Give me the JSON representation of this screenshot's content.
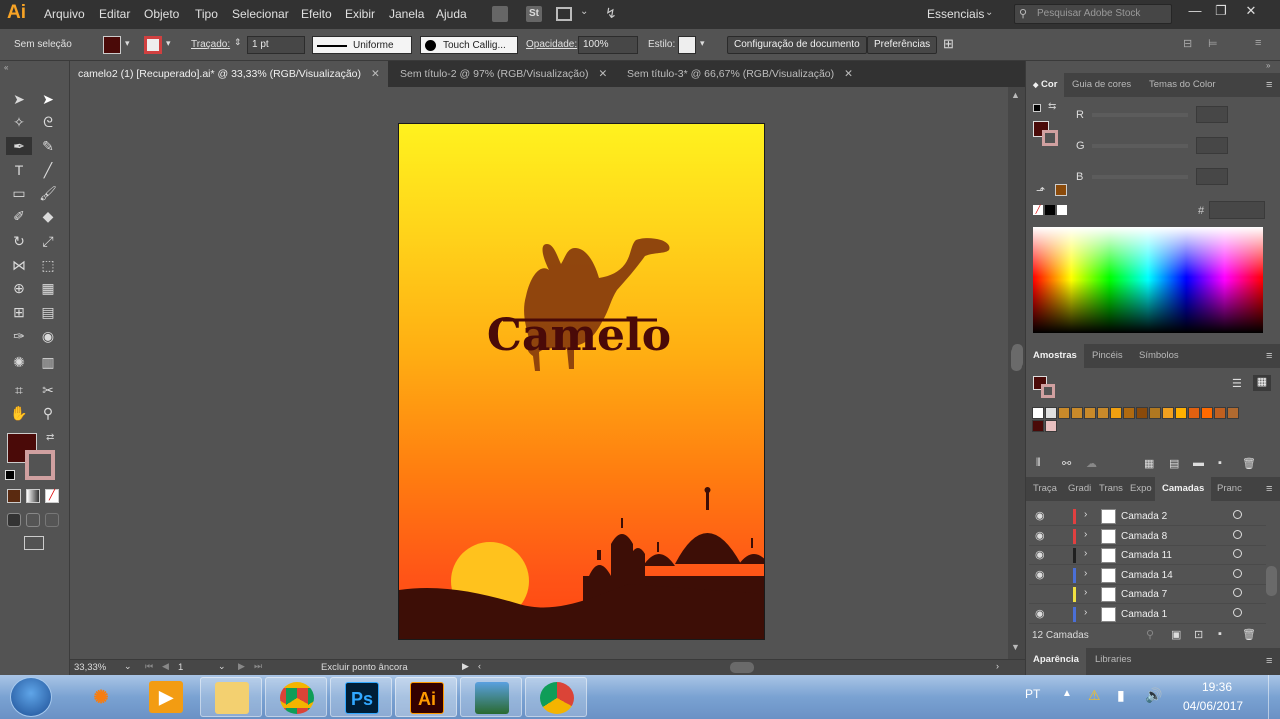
{
  "menubar": {
    "app_logo": "Ai",
    "items": [
      "Arquivo",
      "Editar",
      "Objeto",
      "Tipo",
      "Selecionar",
      "Efeito",
      "Exibir",
      "Janela",
      "Ajuda"
    ],
    "workspace": "Essenciais",
    "search_placeholder": "Pesquisar Adobe Stock"
  },
  "controlbar": {
    "selection": "Sem seleção",
    "stroke_label": "Traçado:",
    "stroke_value": "1 pt",
    "profile": "Uniforme",
    "brush": "Touch Callig...",
    "opacity_label": "Opacidade:",
    "opacity_value": "100%",
    "style_label": "Estilo:",
    "doc_setup_btn": "Configuração de documento",
    "prefs_btn": "Preferências",
    "fill_color": "#4a0a08"
  },
  "tabs": [
    {
      "label": "camelo2 (1) [Recuperado].ai* @ 33,33% (RGB/Visualização)",
      "active": true
    },
    {
      "label": "Sem título-2 @ 97% (RGB/Visualização)",
      "active": false
    },
    {
      "label": "Sem título-3* @ 66,67% (RGB/Visualização)",
      "active": false
    }
  ],
  "artwork": {
    "title_text": "Camelo",
    "silhouette_color": "#3d0e06",
    "camel_color": "#8a3e0d",
    "sun_color": "#ffc21d"
  },
  "statusbar": {
    "zoom": "33,33%",
    "artboard_num": "1",
    "status_text": "Excluir ponto âncora"
  },
  "color_panel": {
    "tabs": [
      "Cor",
      "Guia de cores",
      "Temas do Color"
    ],
    "channels": [
      "R",
      "G",
      "B"
    ],
    "hex_label": "#"
  },
  "swatches_panel": {
    "tabs": [
      "Amostras",
      "Pincéis",
      "Símbolos"
    ],
    "swatches": [
      "#ffffff",
      "#e0e0e0",
      "#c98a2a",
      "#c98a2a",
      "#c98a2a",
      "#c98a2a",
      "#f0a010",
      "#b06a10",
      "#8a4a0a",
      "#b07820",
      "#f0a020",
      "#ffb000",
      "#e06010",
      "#ff6a00",
      "#c06020",
      "#b06a30",
      "#4a0a08",
      "#e8c0c0"
    ]
  },
  "layers_panel": {
    "tabs": [
      "Traça",
      "Gradi",
      "Trans",
      "Expo",
      "Camadas",
      "Pranc"
    ],
    "layers": [
      {
        "name": "Camada 2",
        "color": "#e04040",
        "visible": true
      },
      {
        "name": "Camada 8",
        "color": "#e04040",
        "visible": true
      },
      {
        "name": "Camada 11",
        "color": "#202020",
        "visible": true
      },
      {
        "name": "Camada 14",
        "color": "#4a6fd8",
        "visible": true
      },
      {
        "name": "Camada 7",
        "color": "#f0e040",
        "visible": false
      },
      {
        "name": "Camada 1",
        "color": "#4a6fd8",
        "visible": true
      }
    ],
    "count": "12 Camadas"
  },
  "bottom_panel": {
    "tabs": [
      "Aparência",
      "Libraries"
    ]
  },
  "taskbar": {
    "lang": "PT",
    "time": "19:36",
    "date": "04/06/2017"
  }
}
